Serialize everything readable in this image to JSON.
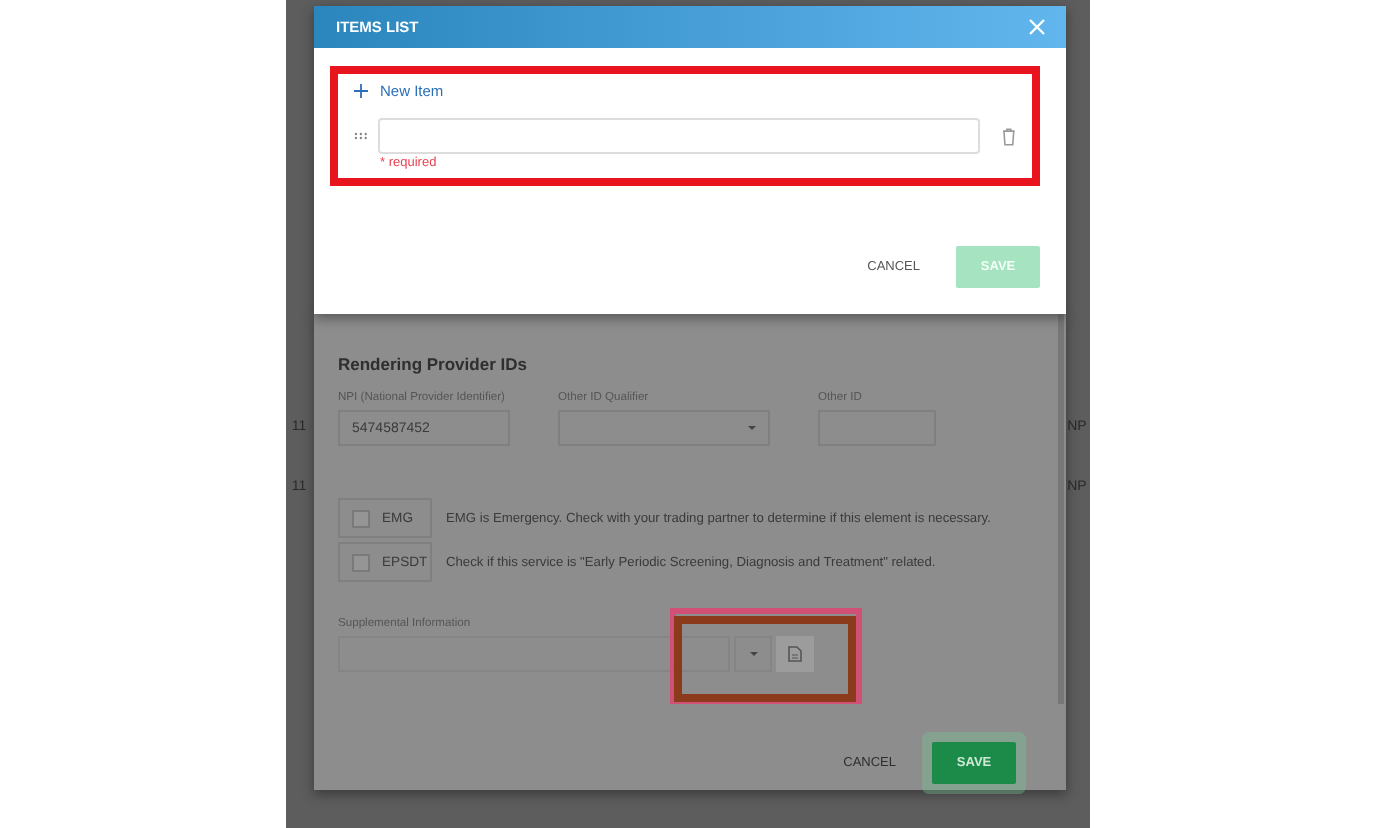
{
  "background": {
    "left_cells": [
      "11",
      "11"
    ],
    "right_cells": [
      "NP",
      "NP"
    ]
  },
  "items_dialog": {
    "title": "ITEMS LIST",
    "new_item_label": "New Item",
    "items": [
      {
        "error": "* required"
      }
    ],
    "cancel": "CANCEL",
    "save": "SAVE",
    "save_disabled": true
  },
  "provider_dialog": {
    "section_title": "Rendering Provider IDs",
    "fields": [
      {
        "kind": "text",
        "label": "NPI (National Provider Identifier)",
        "value": "5474587452"
      },
      {
        "kind": "select",
        "label": "Other ID Qualifier"
      },
      {
        "kind": "text",
        "label": "Other ID"
      }
    ],
    "checks": [
      {
        "label": "EMG",
        "checked": false,
        "description": "EMG is Emergency. Check with your trading partner to determine if this element is necessary."
      },
      {
        "label": "EPSDT",
        "checked": false,
        "description": "Check if this service is \"Early Periodic Screening, Diagnosis and Treatment\" related."
      }
    ],
    "supplemental_label": "Supplemental Information",
    "cancel": "CANCEL",
    "save": "SAVE",
    "save_disabled": false
  }
}
